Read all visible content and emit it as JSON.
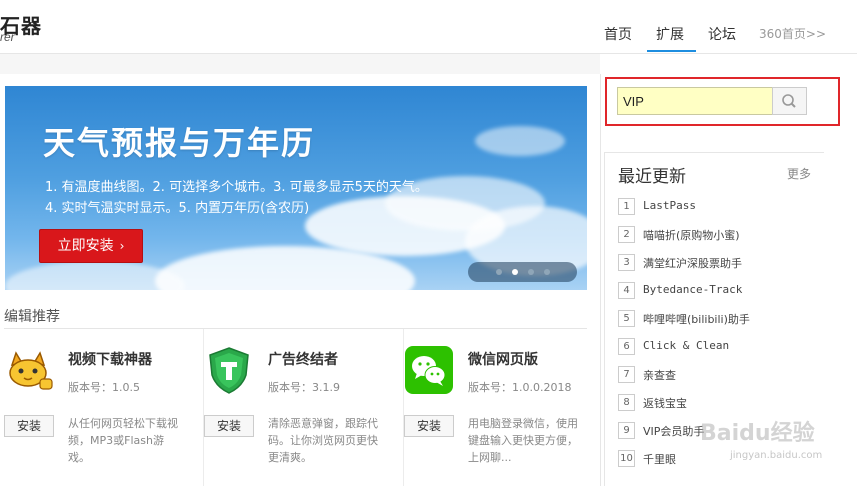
{
  "header": {
    "logo_title": "石器",
    "logo_sub": "rer",
    "nav": [
      "首页",
      "扩展",
      "论坛"
    ],
    "nav_more": "360首页>>"
  },
  "banner": {
    "title": "天气预报与万年历",
    "line1": "1. 有温度曲线图。2. 可选择多个城市。3. 可最多显示5天的天气。",
    "line2": "4. 实时气温实时显示。5. 内置万年历(含农历)",
    "install_label": "立即安装",
    "dots_active_index": 1
  },
  "editor_picks": {
    "title": "编辑推荐",
    "cards": [
      {
        "name": "视频下载神器",
        "version": "版本号：1.0.5",
        "button": "安装",
        "desc": "从任何网页轻松下载视频，MP3或Flash游戏。",
        "icon": "yellow-cat-icon"
      },
      {
        "name": "广告终结者",
        "version": "版本号：3.1.9",
        "button": "安装",
        "desc": "清除恶意弹窗，跟踪代码。让你浏览网页更快更清爽。",
        "icon": "green-shield-icon"
      },
      {
        "name": "微信网页版",
        "version": "版本号：1.0.0.2018",
        "button": "安装",
        "desc": "用电脑登录微信，使用键盘输入更快更方便，上网聊...",
        "icon": "wechat-icon"
      }
    ]
  },
  "search": {
    "value": "VIP",
    "highlight_color": "#e0262a"
  },
  "recent": {
    "title": "最近更新",
    "more": "更多",
    "items": [
      {
        "num": "1",
        "name": "LastPass"
      },
      {
        "num": "2",
        "name": "喵喵折(原购物小蜜)"
      },
      {
        "num": "3",
        "name": "满堂红沪深股票助手"
      },
      {
        "num": "4",
        "name": "Bytedance-Track"
      },
      {
        "num": "5",
        "name": "哔哩哔哩(bilibili)助手"
      },
      {
        "num": "6",
        "name": "Click & Clean"
      },
      {
        "num": "7",
        "name": "亲查查"
      },
      {
        "num": "8",
        "name": "返钱宝宝"
      },
      {
        "num": "9",
        "name": "VIP会员助手"
      },
      {
        "num": "10",
        "name": "千里眼"
      }
    ]
  },
  "watermark": {
    "text": "Baidu经验",
    "sub": "jingyan.baidu.com"
  }
}
